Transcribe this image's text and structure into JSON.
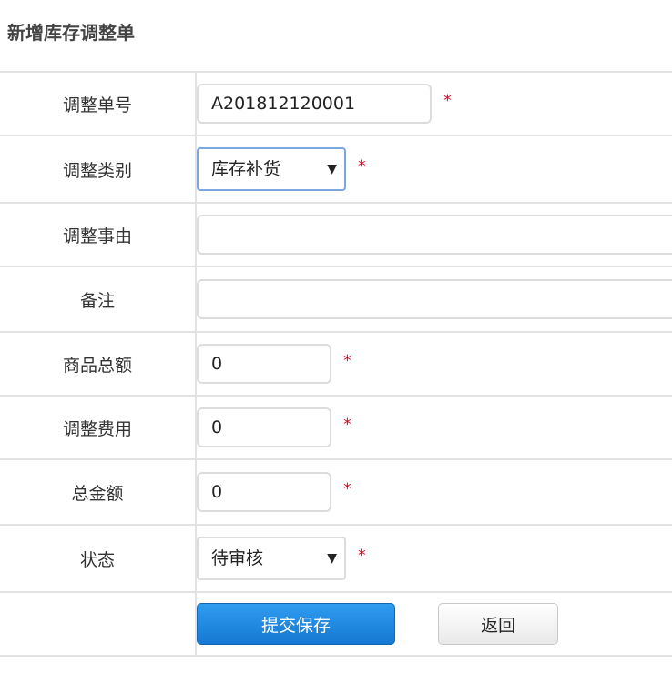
{
  "title": "新增库存调整单",
  "fields": {
    "adjust_no": {
      "label": "调整单号",
      "value": "A201812120001",
      "required": "*"
    },
    "adjust_type": {
      "label": "调整类别",
      "value": "库存补货",
      "required": "*"
    },
    "adjust_reason": {
      "label": "调整事由",
      "value": ""
    },
    "remark": {
      "label": "备注",
      "value": ""
    },
    "goods_total": {
      "label": "商品总额",
      "value": "0",
      "required": "*"
    },
    "adjust_fee": {
      "label": "调整费用",
      "value": "0",
      "required": "*"
    },
    "total_amount": {
      "label": "总金额",
      "value": "0",
      "required": "*"
    },
    "status": {
      "label": "状态",
      "value": "待审核",
      "required": "*"
    }
  },
  "buttons": {
    "submit": "提交保存",
    "back": "返回"
  },
  "icons": {
    "dropdown": "triangle-down-icon"
  },
  "colors": {
    "required": "#d9001b",
    "primary": "#1678d2",
    "focus_border": "#7aa7e0"
  }
}
